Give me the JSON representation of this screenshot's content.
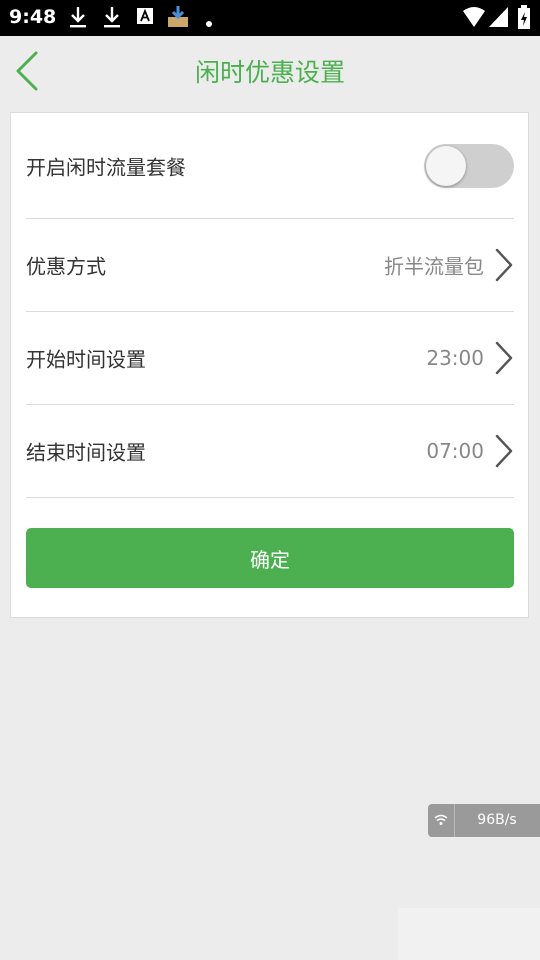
{
  "status_bar": {
    "time": "9:48",
    "icons": [
      "download-icon",
      "download-icon",
      "text-a-icon",
      "inbox-download-icon",
      "dot-icon",
      "wifi-icon",
      "signal-icon",
      "battery-icon"
    ]
  },
  "header": {
    "title": "闲时优惠设置",
    "accent_color": "#4caf50"
  },
  "settings": {
    "toggle_label": "开启闲时流量套餐",
    "toggle_on": false,
    "discount_label": "优惠方式",
    "discount_value": "折半流量包",
    "start_label": "开始时间设置",
    "start_value": "23:00",
    "end_label": "结束时间设置",
    "end_value": "07:00"
  },
  "confirm_label": "确定",
  "speed_widget": {
    "text": "96B/s"
  }
}
